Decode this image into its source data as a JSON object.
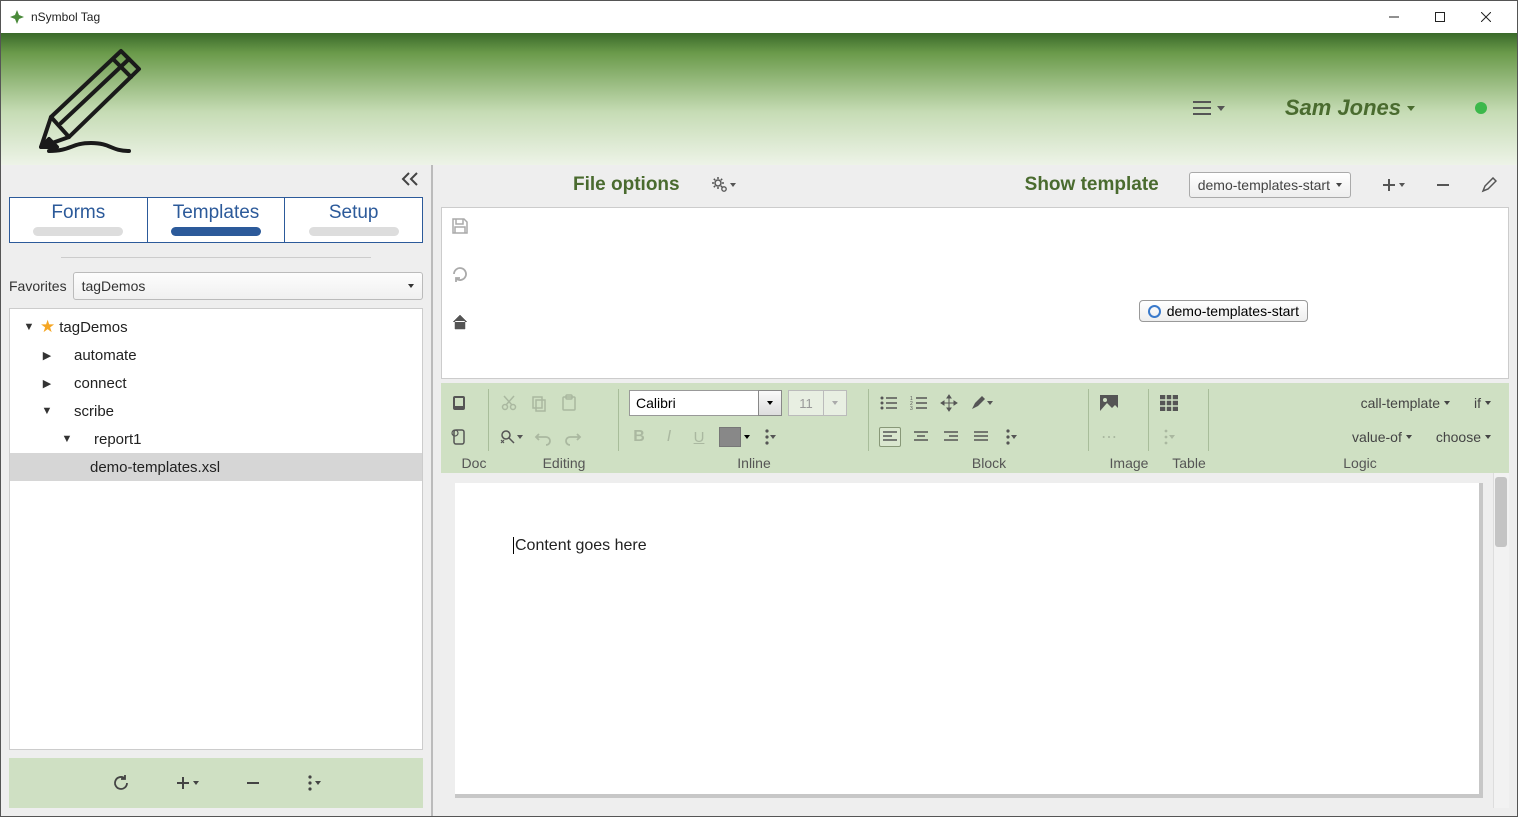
{
  "window": {
    "title": "nSymbol Tag"
  },
  "header": {
    "user": "Sam Jones"
  },
  "sidebar": {
    "tabs": [
      "Forms",
      "Templates",
      "Setup"
    ],
    "active_tab": 1,
    "favorites_label": "Favorites",
    "favorites_value": "tagDemos",
    "tree": {
      "root": "tagDemos",
      "items": [
        "automate",
        "connect",
        "scribe"
      ],
      "sub": "report1",
      "leaf": "demo-templates.xsl"
    }
  },
  "toolbar": {
    "file_options": "File options",
    "show_template": "Show template",
    "template_value": "demo-templates-start"
  },
  "chip": {
    "label": "demo-templates-start"
  },
  "ribbon": {
    "font": "Calibri",
    "size": "11",
    "labels": {
      "doc": "Doc",
      "editing": "Editing",
      "inline": "Inline",
      "block": "Block",
      "image": "Image",
      "table": "Table",
      "logic": "Logic"
    },
    "logic": {
      "call_template": "call-template",
      "if": "if",
      "value_of": "value-of",
      "choose": "choose"
    }
  },
  "document": {
    "content": "Content goes here"
  }
}
